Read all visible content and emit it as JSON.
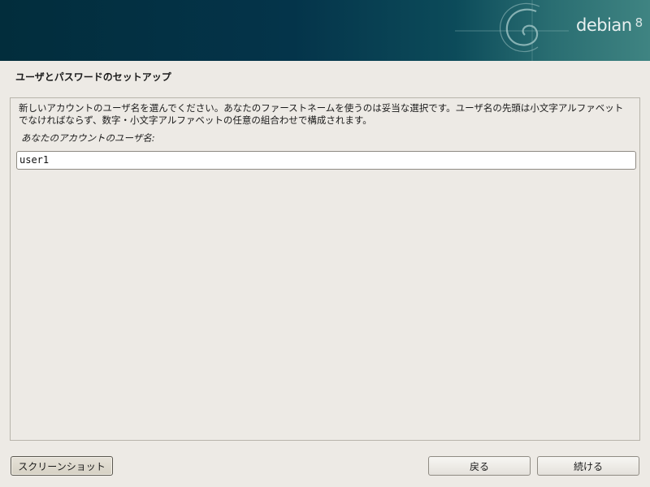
{
  "header": {
    "brand": "debian",
    "version": "8",
    "logo_icon": "debian-swirl-icon"
  },
  "page": {
    "title": "ユーザとパスワードのセットアップ"
  },
  "form": {
    "description": "新しいアカウントのユーザ名を選んでください。あなたのファーストネームを使うのは妥当な選択です。ユーザ名の先頭は小文字アルファベットでなければならず、数字・小文字アルファベットの任意の組合わせで構成されます。",
    "prompt": "あなたのアカウントのユーザ名:",
    "username_value": "user1"
  },
  "buttons": {
    "screenshot": "スクリーンショット",
    "back": "戻る",
    "continue": "続ける"
  }
}
